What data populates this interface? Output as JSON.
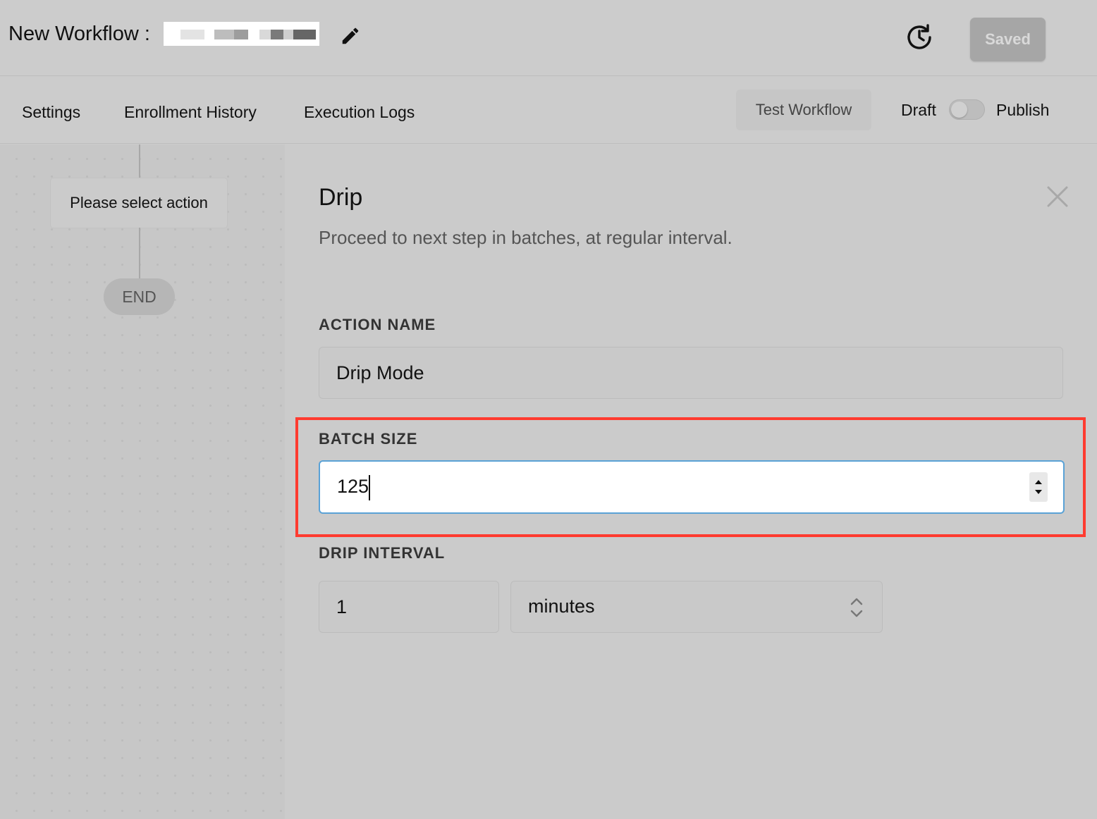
{
  "header": {
    "workflow_title": "New Workflow :",
    "save_status": "Saved"
  },
  "nav": {
    "tabs": [
      "Settings",
      "Enrollment History",
      "Execution Logs"
    ],
    "test_button": "Test Workflow",
    "draft_label": "Draft",
    "publish_label": "Publish",
    "publish_toggle_on": false
  },
  "canvas": {
    "action_node_label": "Please select action",
    "end_node_label": "END"
  },
  "panel": {
    "title": "Drip",
    "description": "Proceed to next step in batches, at regular interval.",
    "action_name_label": "ACTION NAME",
    "action_name_value": "Drip Mode",
    "batch_size_label": "BATCH SIZE",
    "batch_size_value": "125",
    "drip_interval_label": "DRIP INTERVAL",
    "drip_interval_value": "1",
    "drip_interval_unit": "minutes"
  },
  "icons": {
    "edit": "pencil-icon",
    "history": "history-icon",
    "close": "close-icon",
    "spinner": "number-spinner-icon",
    "select": "chevron-up-down-icon"
  },
  "colors": {
    "focus_border": "#5aa2d6",
    "highlight": "#ff3b30",
    "saved_button": "#a6a6a6"
  }
}
